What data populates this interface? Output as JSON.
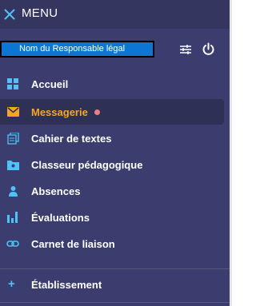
{
  "header": {
    "title": "MENU"
  },
  "user": {
    "name": "Nom du Responsable légal"
  },
  "nav": {
    "items": [
      {
        "label": "Accueil",
        "icon": "grid-icon"
      },
      {
        "label": "Messagerie",
        "icon": "envelope-icon",
        "active": true,
        "notification": true
      },
      {
        "label": "Cahier de textes",
        "icon": "notebook-icon"
      },
      {
        "label": "Classeur pédagogique",
        "icon": "folder-icon"
      },
      {
        "label": "Absences",
        "icon": "person-icon"
      },
      {
        "label": "Évaluations",
        "icon": "bar-chart-icon"
      },
      {
        "label": "Carnet de liaison",
        "icon": "link-icon"
      }
    ]
  },
  "section": {
    "label": "Établissement",
    "icon": "plus-icon"
  },
  "colors": {
    "background": "#3b3d6e",
    "active_label": "#f5a623",
    "icon_accent": "#4fc3f7",
    "notification": "#ef7f7f"
  }
}
